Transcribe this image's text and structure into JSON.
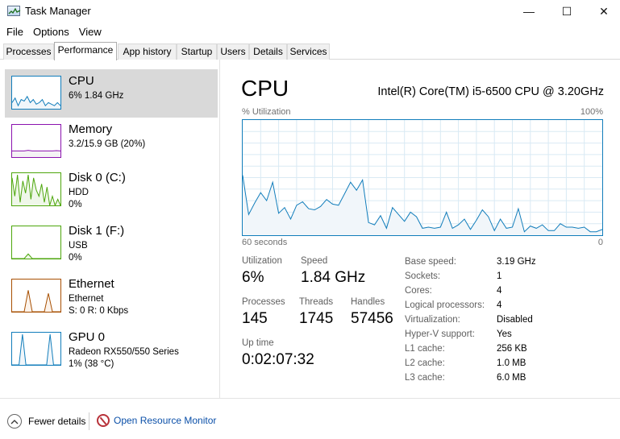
{
  "window": {
    "title": "Task Manager",
    "minimize": "—",
    "maximize": "☐",
    "close": "✕",
    "icon": "task-manager-icon"
  },
  "menu": [
    "File",
    "Options",
    "View"
  ],
  "tabs": [
    {
      "label": "Processes"
    },
    {
      "label": "Performance",
      "active": true
    },
    {
      "label": "App history"
    },
    {
      "label": "Startup"
    },
    {
      "label": "Users"
    },
    {
      "label": "Details"
    },
    {
      "label": "Services"
    }
  ],
  "sidebar": {
    "items": [
      {
        "name": "CPU",
        "line1": "6% 1.84 GHz",
        "line2": "",
        "color": "#117dbb",
        "fill": "#f1f6fa",
        "selected": true,
        "spark": [
          0.2,
          0.35,
          0.1,
          0.3,
          0.25,
          0.4,
          0.2,
          0.3,
          0.15,
          0.2,
          0.3,
          0.1,
          0.2,
          0.15,
          0.1,
          0.2,
          0.1
        ]
      },
      {
        "name": "Memory",
        "line1": "3.2/15.9 GB (20%)",
        "line2": "",
        "color": "#8b12ae",
        "fill": "#f4f2f4",
        "selected": false,
        "spark": [
          0.2,
          0.2,
          0.2,
          0.2,
          0.22,
          0.2,
          0.2,
          0.2,
          0.2,
          0.2,
          0.2,
          0.21,
          0.2
        ]
      },
      {
        "name": "Disk 0 (C:)",
        "line1": "HDD",
        "line2": "0%",
        "color": "#4da60c",
        "fill": "#eff7e9",
        "selected": false,
        "spark": [
          0.9,
          0.3,
          1.0,
          0.1,
          0.8,
          0.4,
          1.0,
          0.2,
          0.9,
          0.5,
          0.3,
          0.7,
          0.1,
          0.6,
          0.0,
          0.3,
          0.0,
          0.2,
          0.0
        ]
      },
      {
        "name": "Disk 1 (F:)",
        "line1": "USB",
        "line2": "0%",
        "color": "#4da60c",
        "fill": "#eff7e9",
        "selected": false,
        "spark": [
          0.0,
          0.0,
          0.0,
          0.0,
          0.15,
          0.0,
          0.0,
          0.0,
          0.0,
          0.0,
          0.0,
          0.0,
          0.0
        ]
      },
      {
        "name": "Ethernet",
        "line1": "Ethernet",
        "line2": "S: 0 R: 0 Kbps",
        "color": "#a74f01",
        "fill": "#fcf3eb",
        "selected": false,
        "spark": [
          0.0,
          0.0,
          0.0,
          0.0,
          0.7,
          0.0,
          0.0,
          0.0,
          0.0,
          0.6,
          0.0,
          0.0,
          0.0
        ]
      },
      {
        "name": "GPU 0",
        "line1": "Radeon RX550/550 Series",
        "line2": "1% (38 °C)",
        "color": "#117dbb",
        "fill": "#f1f6fa",
        "selected": false,
        "spark": [
          0.0,
          0.0,
          0.0,
          1.0,
          0.0,
          0.0,
          0.0,
          0.0,
          0.0,
          0.0,
          0.0,
          1.0,
          0.0,
          0.0,
          0.0
        ]
      }
    ]
  },
  "main": {
    "title": "CPU",
    "model": "Intel(R) Core(TM) i5-6500 CPU @ 3.20GHz",
    "graph": {
      "label_left": "% Utilization",
      "label_right": "100%",
      "axis_left": "60 seconds",
      "axis_right": "0",
      "line_color": "#117dbb",
      "fill_color": "#f1f6fa",
      "grid_color": "#d9eaf4",
      "values": [
        52,
        18,
        28,
        37,
        30,
        46,
        19,
        24,
        14,
        26,
        29,
        23,
        22,
        25,
        31,
        27,
        26,
        36,
        46,
        39,
        48,
        11,
        9,
        17,
        6,
        24,
        18,
        12,
        20,
        16,
        6,
        7,
        6,
        7,
        20,
        6,
        9,
        14,
        5,
        13,
        22,
        16,
        4,
        14,
        6,
        7,
        23,
        3,
        8,
        6,
        9,
        4,
        4,
        10,
        7,
        7,
        6,
        7,
        3,
        3,
        5
      ]
    },
    "stats": {
      "utilization_label": "Utilization",
      "utilization": "6%",
      "speed_label": "Speed",
      "speed": "1.84 GHz",
      "processes_label": "Processes",
      "processes": "145",
      "threads_label": "Threads",
      "threads": "1745",
      "handles_label": "Handles",
      "handles": "57456",
      "uptime_label": "Up time",
      "uptime": "0:02:07:32"
    },
    "specs": [
      {
        "key": "Base speed:",
        "value": "3.19 GHz"
      },
      {
        "key": "Sockets:",
        "value": "1"
      },
      {
        "key": "Cores:",
        "value": "4"
      },
      {
        "key": "Logical processors:",
        "value": "4"
      },
      {
        "key": "Virtualization:",
        "value": "Disabled"
      },
      {
        "key": "Hyper-V support:",
        "value": "Yes"
      },
      {
        "key": "L1 cache:",
        "value": "256 KB"
      },
      {
        "key": "L2 cache:",
        "value": "1.0 MB"
      },
      {
        "key": "L3 cache:",
        "value": "6.0 MB"
      }
    ]
  },
  "footer": {
    "fewer_details": "Fewer details",
    "open_resource_monitor": "Open Resource Monitor"
  }
}
